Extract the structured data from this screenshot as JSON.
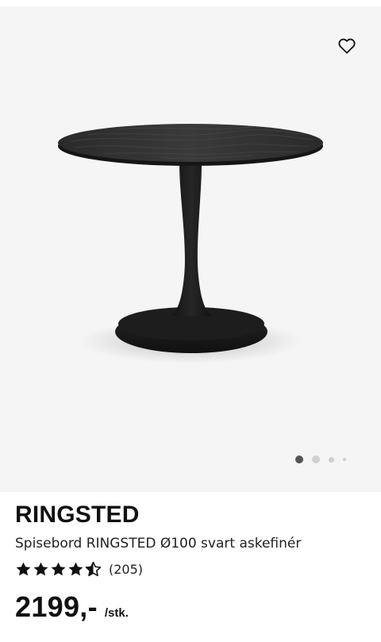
{
  "product": {
    "name": "RINGSTED",
    "description": "Spisebord RINGSTED Ø100 svart askefinér",
    "rating": 4.5,
    "rating_max": 5,
    "review_count": "(205)",
    "price": "2199,-",
    "price_unit": "/stk."
  },
  "gallery": {
    "image_count": 4,
    "active_index": 0,
    "favorite_icon": "heart-outline-icon"
  },
  "colors": {
    "image_background": "#f5f5f5",
    "dot_active": "#555555",
    "dot_inactive": "#d0d0d0",
    "table_color": "#1c1c1c"
  }
}
